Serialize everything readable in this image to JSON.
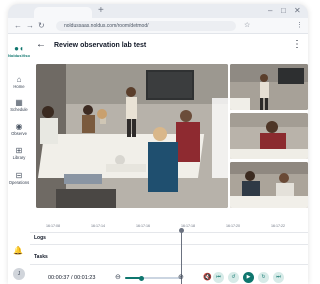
{
  "browser": {
    "new_tab_glyph": "+",
    "window_minimize_glyph": "–",
    "window_maximize_glyph": "□",
    "window_close_glyph": "✕",
    "back_glyph": "←",
    "forward_glyph": "→",
    "reload_glyph": "↻",
    "url": "noldussaas.noldus.com/room/detmod/",
    "bookmark_glyph": "☆",
    "menu_glyph": "⋮"
  },
  "app": {
    "logo_glyph": "●◖",
    "logo_text": "NoldusViso",
    "sidebar": {
      "items": [
        {
          "icon": "⌂",
          "label": "Home",
          "icon_name": "home-icon"
        },
        {
          "icon": "▦",
          "label": "Schedule",
          "icon_name": "calendar-icon"
        },
        {
          "icon": "◉",
          "label": "Observe",
          "icon_name": "eye-icon"
        },
        {
          "icon": "⊞",
          "label": "Library",
          "icon_name": "library-icon"
        },
        {
          "icon": "⊟",
          "label": "Operations",
          "icon_name": "operations-icon"
        }
      ],
      "bell_glyph": "🔔",
      "avatar_initial": "J"
    },
    "header": {
      "back_glyph": "←",
      "title": "Review observation lab test",
      "more_glyph": "⋮"
    },
    "timeline": {
      "ticks": [
        "16:17:08",
        "16:17:14",
        "16:17:16",
        "16:17:18",
        "16:17:20",
        "16:17:22",
        "16:17:24"
      ],
      "rows": [
        "Logs",
        "Tasks"
      ]
    },
    "controls": {
      "current_time": "00:00:37",
      "separator": "/",
      "total_time": "00:01:23",
      "zoom_out_glyph": "⊖",
      "zoom_in_glyph": "⊕",
      "zoom_level": 0.3,
      "mute_glyph": "🔇",
      "buttons": [
        {
          "glyph": "⏮",
          "name": "skip-start-icon"
        },
        {
          "glyph": "↺",
          "name": "rewind-icon"
        },
        {
          "glyph": "▶",
          "name": "play-icon"
        },
        {
          "glyph": "↻",
          "name": "forward-icon"
        },
        {
          "glyph": "⏭",
          "name": "skip-end-icon"
        }
      ]
    },
    "accent_color": "#0f766e"
  }
}
